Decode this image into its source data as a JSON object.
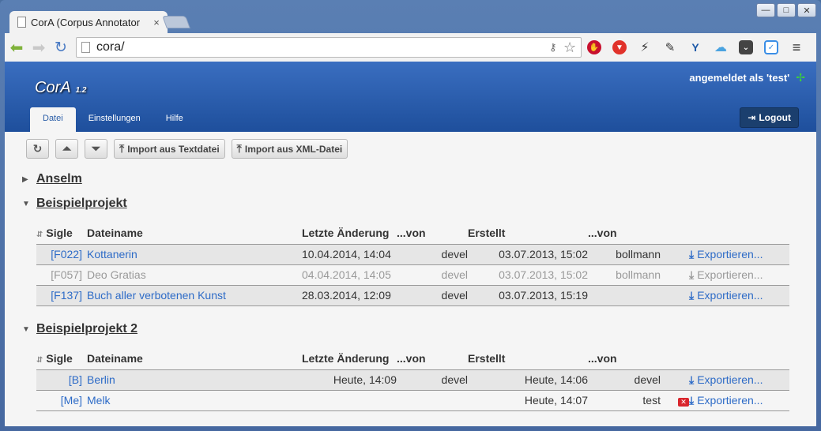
{
  "browser": {
    "tab_title": "CorA (Corpus Annotator",
    "tab_close": "×",
    "url": "cora/",
    "window_buttons": [
      "—",
      "□",
      "✕"
    ]
  },
  "app": {
    "name": "CorA",
    "version": "1.2",
    "user_status": "angemeldet als 'test'",
    "logout_label": "Logout",
    "nav": [
      "Datei",
      "Einstellungen",
      "Hilfe"
    ]
  },
  "actions": {
    "import_text": "Import aus Textdatei",
    "import_xml": "Import aus XML-Datei"
  },
  "columns": {
    "sigle": "Sigle",
    "name": "Dateiname",
    "modified": "Letzte Änderung",
    "modified_by": "...von",
    "created": "Erstellt",
    "created_by": "...von"
  },
  "export_label": "Exportieren...",
  "projects": [
    {
      "name": "Anselm",
      "expanded": false
    },
    {
      "name": "Beispielprojekt",
      "expanded": true,
      "files": [
        {
          "sigle": "[F022]",
          "name": "Kottanerin",
          "modified": "10.04.2014, 14:04",
          "modified_by": "devel",
          "created": "03.07.2013, 15:02",
          "created_by": "bollmann",
          "state": "normal"
        },
        {
          "sigle": "[F057]",
          "name": "Deo Gratias",
          "modified": "04.04.2014, 14:05",
          "modified_by": "devel",
          "created": "03.07.2013, 15:02",
          "created_by": "bollmann",
          "state": "disabled"
        },
        {
          "sigle": "[F137]",
          "name": "Buch aller verbotenen Kunst",
          "modified": "28.03.2014, 12:09",
          "modified_by": "devel",
          "created": "03.07.2013, 15:19",
          "created_by": "",
          "state": "normal"
        }
      ]
    },
    {
      "name": "Beispielprojekt 2",
      "expanded": true,
      "files": [
        {
          "sigle": "[B]",
          "name": "Berlin",
          "modified": "Heute, 14:09",
          "modified_by": "devel",
          "created": "Heute, 14:06",
          "created_by": "devel",
          "state": "normal"
        },
        {
          "sigle": "[Me]",
          "name": "Melk",
          "modified": "",
          "modified_by": "",
          "created": "Heute, 14:07",
          "created_by": "test",
          "state": "deletable"
        }
      ]
    }
  ],
  "colors": {
    "header": "#2a5ba8",
    "link": "#2d6bc7",
    "delete": "#d9262d"
  }
}
